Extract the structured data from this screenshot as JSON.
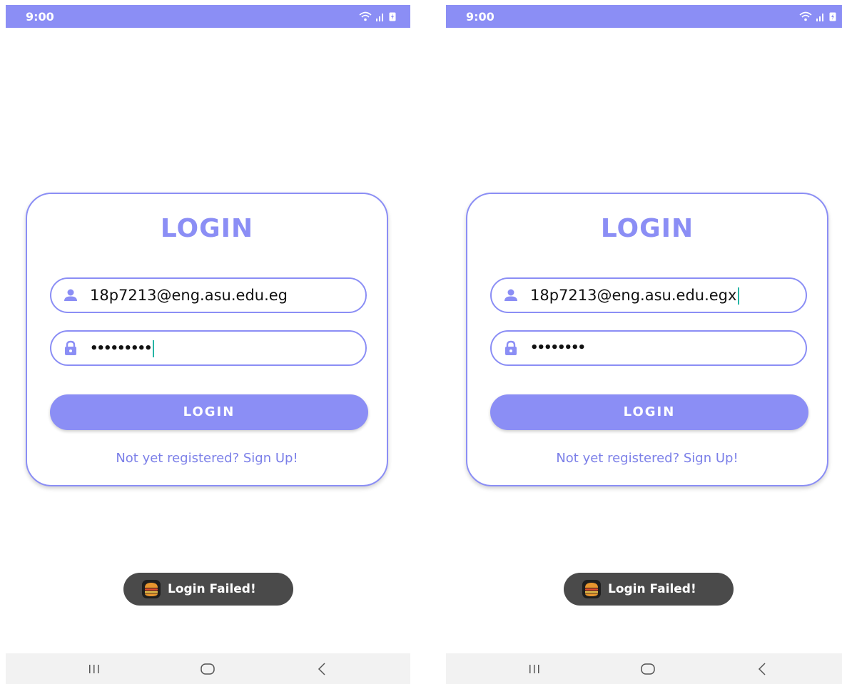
{
  "colors": {
    "primary": "#8b8ef5",
    "status_bar": "#8b8ef5",
    "toast_bg": "#4a4a4a",
    "cursor": "#26b5a5",
    "nav_bar": "#f2f2f2"
  },
  "screens": [
    {
      "status_bar": {
        "time": "9:00",
        "icons": [
          "wifi-icon",
          "signal-icon",
          "battery-charging-icon"
        ]
      },
      "title": "LOGIN",
      "email_field": {
        "value": "18p7213@eng.asu.edu.eg",
        "icon": "person-icon"
      },
      "password_field": {
        "value": "•••••••••",
        "icon": "lock-icon",
        "focused": true
      },
      "login_button": "LOGIN",
      "signup_link": "Not yet registered? Sign Up!",
      "toast": {
        "text": "Login Failed!",
        "icon": "app-burger-icon"
      },
      "nav": [
        "recent-apps",
        "home",
        "back"
      ]
    },
    {
      "status_bar": {
        "time": "9:00",
        "icons": [
          "wifi-icon",
          "signal-icon",
          "battery-charging-icon"
        ]
      },
      "title": "LOGIN",
      "email_field": {
        "value": "18p7213@eng.asu.edu.egx",
        "icon": "person-icon",
        "focused": true
      },
      "password_field": {
        "value": "••••••••",
        "icon": "lock-icon"
      },
      "login_button": "LOGIN",
      "signup_link": "Not yet registered? Sign Up!",
      "toast": {
        "text": "Login Failed!",
        "icon": "app-burger-icon"
      },
      "nav": [
        "recent-apps",
        "home",
        "back"
      ]
    }
  ]
}
